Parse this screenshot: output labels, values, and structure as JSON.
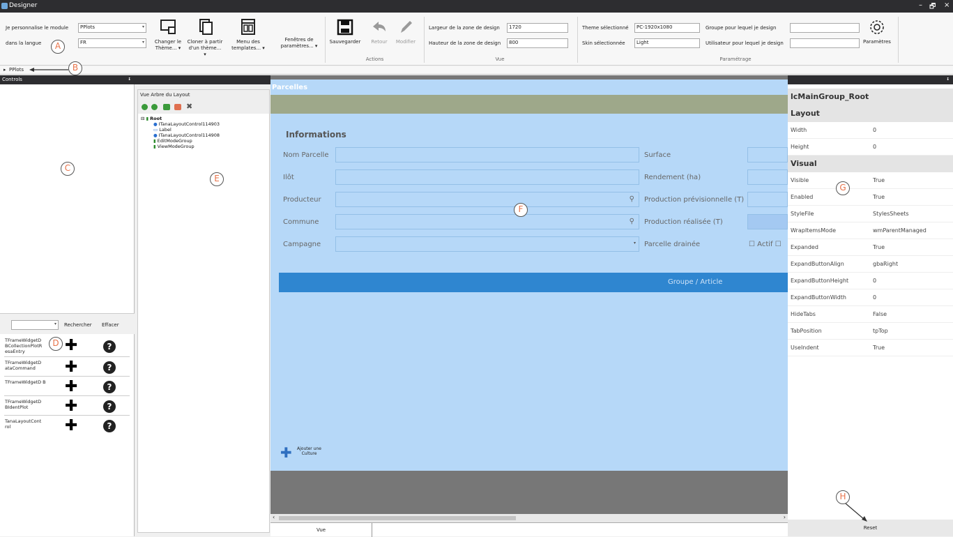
{
  "window": {
    "title": "Designer",
    "controls": [
      "–",
      "🗗",
      "×"
    ]
  },
  "ribbon": {
    "module_label": "Je personnalise le module",
    "module_value": "PPlots",
    "language_label": "dans la langue",
    "language_value": "FR",
    "buttons": {
      "change_theme": [
        "Changer le",
        "Thème..."
      ],
      "clone_theme": [
        "Cloner à partir",
        "d'un thème..."
      ],
      "templates_menu": [
        "Menu des",
        "templates..."
      ],
      "param_windows": [
        "Fenêtres de",
        "paramètres..."
      ],
      "save": "Sauvegarder",
      "back": "Retour",
      "edit": "Modifier",
      "settings": "Paramètres"
    },
    "groups": {
      "actions": "Actions",
      "view": "Vue",
      "settings": "Paramétrage"
    },
    "design_width_label": "Largeur de la zone de design",
    "design_width_value": "1720",
    "design_height_label": "Hauteur de la zone de design",
    "design_height_value": "800",
    "theme_label": "Theme sélectionné",
    "theme_value": "PC-1920x1080",
    "skin_label": "Skin sélectionnée",
    "skin_value": "Light",
    "group_label": "Groupe pour lequel je design",
    "group_value": "",
    "user_label": "Utilisateur pour lequel je design",
    "user_value": ""
  },
  "path": {
    "item": "PPlots"
  },
  "controls_panel": {
    "title": "Controls",
    "pin": "ᵻ",
    "search_button": "Rechercher",
    "clear_button": "Effacer",
    "items": [
      "TFrameWidgetD BCollectionPlotR esaEntry",
      "TFrameWidgetD ataCommand",
      "TFrameWidgetD B",
      "TFrameWidgetD BIdentPlot",
      "TanaLayoutCont rol"
    ]
  },
  "tree": {
    "title": "Vue Arbre du Layout",
    "root": "Root",
    "children": [
      "ITanaLayoutControl114903",
      "Label",
      "ITanaLayoutControl114908",
      "EditModeGroup",
      "ViewModeGroup"
    ]
  },
  "form": {
    "tab": "Parcelles",
    "section": "Informations",
    "left_fields": [
      "Nom Parcelle",
      "Ilôt",
      "Producteur",
      "Commune",
      "Campagne"
    ],
    "right_fields": [
      "Surface",
      "Rendement (ha)",
      "Production prévisionnelle (T)",
      "Production réalisée (T)",
      "Parcelle drainée"
    ],
    "checkbox_label": "Actif",
    "grid_header": "Groupe / Article",
    "add_culture": [
      "Ajouter une",
      "Culture"
    ]
  },
  "bottom": {
    "tab": "Vue"
  },
  "properties": {
    "title": "lcMainGroup_Root",
    "pin": "ᵻ",
    "sections": [
      {
        "name": "Layout",
        "rows": [
          [
            "Width",
            "0"
          ],
          [
            "Height",
            "0"
          ]
        ]
      },
      {
        "name": "Visual",
        "rows": [
          [
            "Visible",
            "True"
          ],
          [
            "Enabled",
            "True"
          ],
          [
            "StyleFile",
            "StylesSheets"
          ],
          [
            "WrapItemsMode",
            "wmParentManaged"
          ],
          [
            "Expanded",
            "True"
          ],
          [
            "ExpandButtonAlign",
            "gbaRight"
          ],
          [
            "ExpandButtonHeight",
            "0"
          ],
          [
            "ExpandButtonWidth",
            "0"
          ],
          [
            "HideTabs",
            "False"
          ],
          [
            "TabPosition",
            "tpTop"
          ],
          [
            "UseIndent",
            "True"
          ]
        ]
      }
    ],
    "reset_button": "Reset"
  },
  "annotations": [
    "A",
    "B",
    "C",
    "D",
    "E",
    "F",
    "G",
    "H"
  ],
  "colors": {
    "accent_orange": "#e8734a",
    "form_blue": "#b6d8f8",
    "grid_header_blue": "#2f86d0",
    "tab_strip": "#9ea88a"
  }
}
